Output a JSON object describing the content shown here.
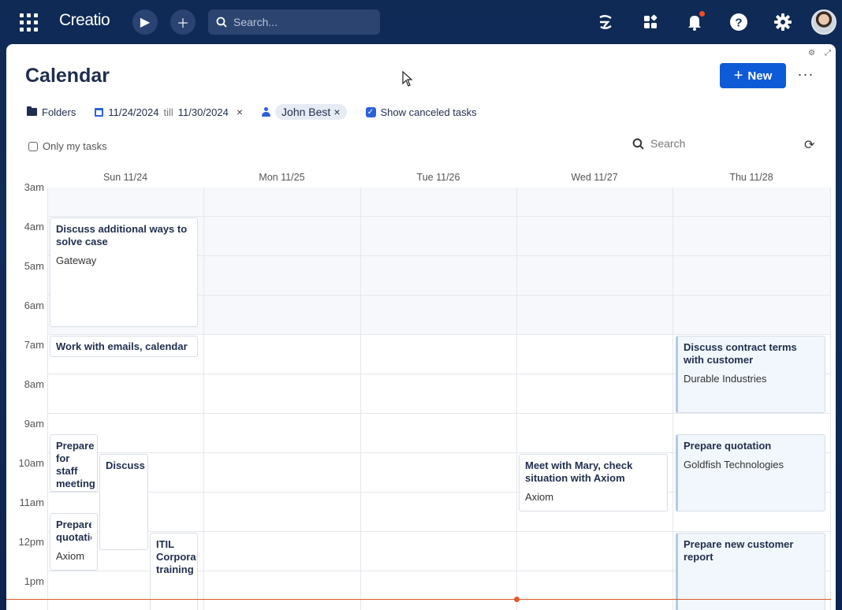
{
  "app": {
    "logo": "Creatio"
  },
  "topbar": {
    "search_placeholder": "Search..."
  },
  "page": {
    "title": "Calendar",
    "new_label": "New",
    "more": "···"
  },
  "filters": {
    "folders_label": "Folders",
    "date_from": "11/24/2024",
    "date_till_word": "till",
    "date_to": "11/30/2024",
    "owner": "John Best",
    "show_canceled": "Show canceled tasks",
    "only_my_tasks": "Only my tasks",
    "search_placeholder": "Search"
  },
  "calendar": {
    "days": [
      "Sun 11/24",
      "Mon 11/25",
      "Tue 11/26",
      "Wed 11/27",
      "Thu 11/28"
    ],
    "today": "Wed 11/27",
    "hours": [
      "3am",
      "4am",
      "5am",
      "6am",
      "7am",
      "8am",
      "9am",
      "10am",
      "11am",
      "12pm",
      "1pm"
    ],
    "events": [
      {
        "title": "Discuss additional ways to solve case",
        "subtitle": "Gateway"
      },
      {
        "title": "Work with emails, calendar",
        "subtitle": ""
      },
      {
        "title": "Prepare for staff meeting",
        "subtitle": ""
      },
      {
        "title": "Discuss c",
        "subtitle": ""
      },
      {
        "title": "Prepare quotatio",
        "subtitle": "Axiom"
      },
      {
        "title": "ITIL Corpora training",
        "subtitle": ""
      },
      {
        "title": "Meet with Mary, check situation with Axiom",
        "subtitle": "Axiom"
      },
      {
        "title": "Discuss contract terms with customer",
        "subtitle": "Durable Industries"
      },
      {
        "title": "Prepare quotation",
        "subtitle": "Goldfish Technologies"
      },
      {
        "title": "Prepare new customer report",
        "subtitle": ""
      }
    ]
  },
  "colors": {
    "accent": "#0d5bd7",
    "today_marker": "#e0592a",
    "topbar_bg": "#0f2a55"
  }
}
